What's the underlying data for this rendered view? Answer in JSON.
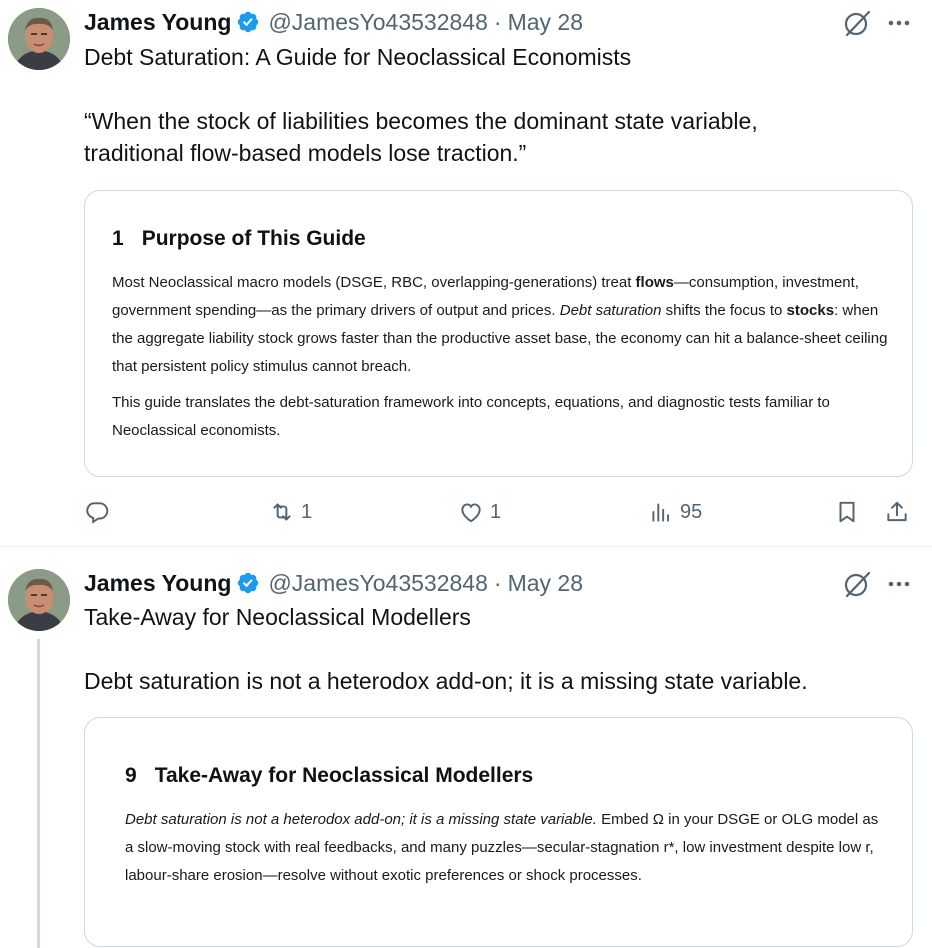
{
  "tweets": [
    {
      "author": {
        "name": "James Young",
        "handle": "@JamesYo43532848"
      },
      "separator": "·",
      "date": "May 28",
      "text_title": "Debt Saturation: A Guide for Neoclassical Economists",
      "text_quote_line1": "“When the stock of liabilities becomes the dominant state variable,",
      "text_quote_line2": "traditional flow-based models lose traction.”",
      "card": {
        "section_number": "1",
        "section_title": "Purpose of This Guide",
        "p1": {
          "a": "Most Neoclassical macro models (DSGE, RBC, overlapping-generations) treat ",
          "b_bold": "flows",
          "c": "—consumption, investment, government spending—as the primary drivers of output and prices. ",
          "d_italic": "Debt saturation",
          "e": " shifts the focus to ",
          "f_bold": "stocks",
          "g": ": when the aggregate liability stock grows faster than the productive asset base, the economy can hit a balance-sheet ceiling that persistent policy stimulus cannot breach."
        },
        "p2": "This guide translates the debt-saturation framework into concepts, equations, and diagnostic tests familiar to Neoclassical economists."
      },
      "actions": {
        "replies": "",
        "reposts": "1",
        "likes": "1",
        "views": "95"
      }
    },
    {
      "author": {
        "name": "James Young",
        "handle": "@JamesYo43532848"
      },
      "separator": "·",
      "date": "May 28",
      "text_title": "Take-Away for Neoclassical Modellers",
      "text_body": "Debt saturation is not a heterodox add-on; it is a missing state variable.",
      "card": {
        "section_number": "9",
        "section_title": "Take-Away for Neoclassical Modellers",
        "p1": {
          "a_italic": "Debt saturation is not a heterodox add-on; it is a missing state variable.",
          "b": " Embed Ω in your DSGE or OLG model as a slow-moving stock with real feedbacks, and many puzzles—secular-stagnation r*, low investment despite low r, labour-share erosion—resolve without exotic preferences or shock processes."
        }
      }
    }
  ],
  "icons": {
    "verified": "verified-badge-icon",
    "grok": "grok-icon",
    "more": "more-icon",
    "reply": "reply-icon",
    "repost": "repost-icon",
    "like": "like-icon",
    "views": "views-icon",
    "bookmark": "bookmark-icon",
    "share": "share-icon"
  },
  "colors": {
    "verified": "#1d9bf0",
    "muted": "#536471",
    "border": "#cfd9de"
  }
}
